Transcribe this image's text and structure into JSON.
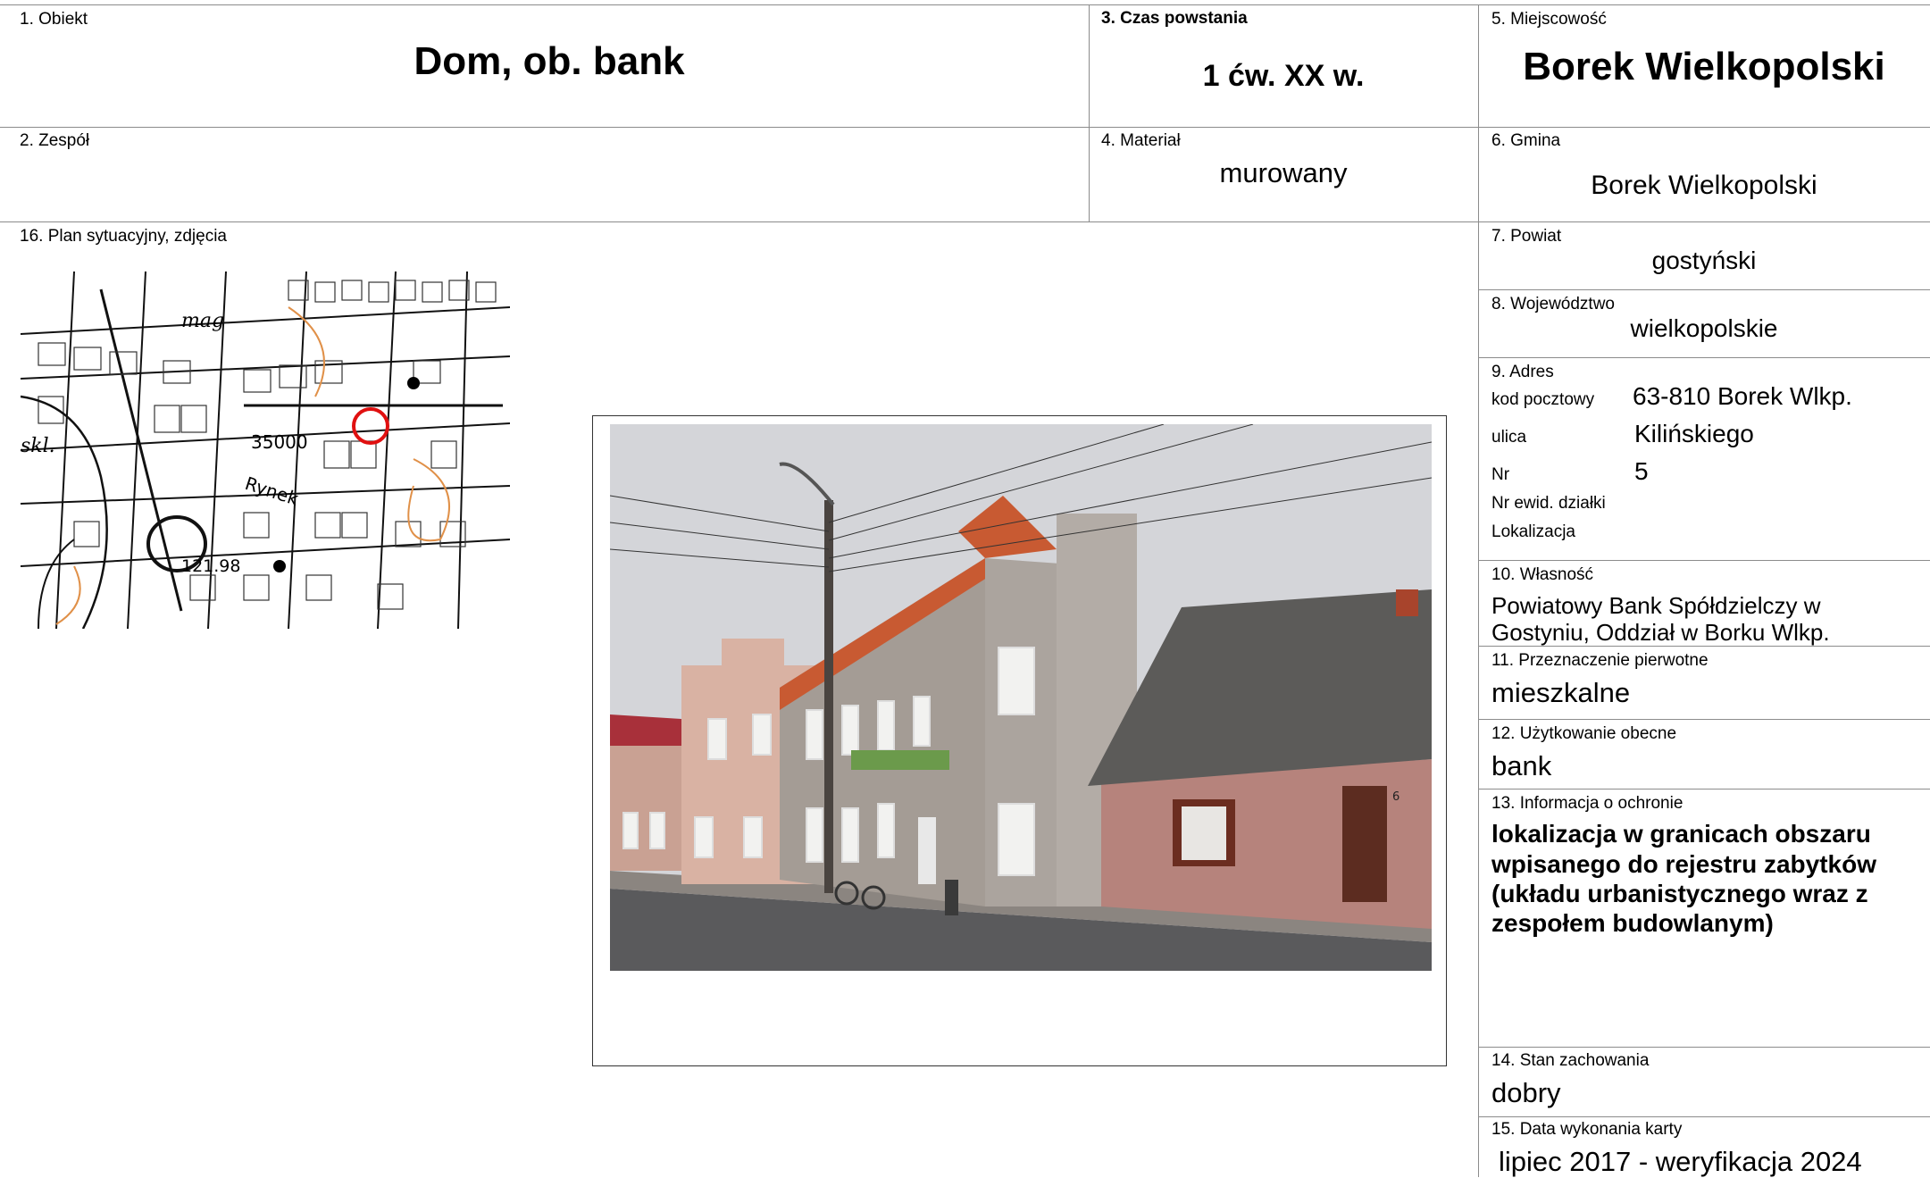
{
  "fields": {
    "obiekt": {
      "label": "1. Obiekt",
      "value": "Dom, ob. bank"
    },
    "czas": {
      "label": "3. Czas powstania",
      "value": "1 ćw. XX w."
    },
    "miejscowosc": {
      "label": "5. Miejscowość",
      "value": "Borek Wielkopolski"
    },
    "zespol": {
      "label": "2. Zespół",
      "value": ""
    },
    "material": {
      "label": "4. Materiał",
      "value": "murowany"
    },
    "gmina": {
      "label": "6. Gmina",
      "value": "Borek Wielkopolski"
    },
    "plan": {
      "label": "16. Plan sytuacyjny, zdjęcia"
    },
    "powiat": {
      "label": "7. Powiat",
      "value": "gostyński"
    },
    "wojewodztwo": {
      "label": "8. Województwo",
      "value": "wielkopolskie"
    },
    "adres": {
      "label": "9. Adres",
      "kod_label": "kod pocztowy",
      "kod_value": "63-810 Borek Wlkp.",
      "ulica_label": "ulica",
      "ulica_value": "Kilińskiego",
      "nr_label": "Nr",
      "nr_value": "5",
      "dzialka_label": "Nr ewid. działki",
      "lokalizacja_label": "Lokalizacja"
    },
    "wlasnosc": {
      "label": "10. Własność",
      "line1": "Powiatowy Bank Spółdzielczy w",
      "line2": "Gostyniu, Oddział w Borku Wlkp."
    },
    "przeznaczenie": {
      "label": "11. Przeznaczenie pierwotne",
      "value": "mieszkalne"
    },
    "uzytkowanie": {
      "label": "12. Użytkowanie obecne",
      "value": "bank"
    },
    "ochrona": {
      "label": "13. Informacja o ochronie",
      "line1": "lokalizacja w granicach obszaru",
      "line2": "wpisanego do rejestru zabytków",
      "line3": "(układu urbanistycznego wraz z",
      "line4": "zespołem budowlanym)"
    },
    "stan": {
      "label": "14. Stan zachowania",
      "value": "dobry"
    },
    "data": {
      "label": "15. Data wykonania karty",
      "value": "lipiec 2017 - weryfikacja 2024"
    }
  },
  "map": {
    "labels": [
      "35000",
      "Rynek",
      "121.98",
      "mag",
      "skl."
    ],
    "marker_color": "#e01010"
  },
  "photo": {
    "house_number": "6"
  }
}
